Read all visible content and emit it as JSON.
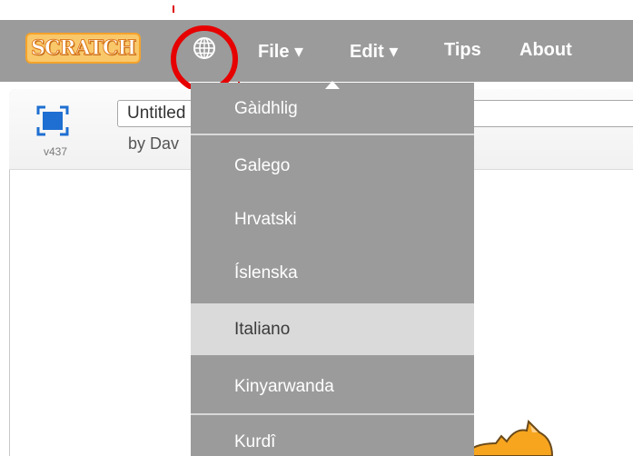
{
  "menubar": {
    "logo_text": "SCRATCH",
    "globe_icon": "globe-icon",
    "file_label": "File ▾",
    "edit_label": "Edit ▾",
    "tips_label": "Tips",
    "about_label": "About",
    "highlight_color": "#e60000",
    "bar_color": "#9b9b9b"
  },
  "project": {
    "title_value": "Untitled",
    "byline": "by Dav",
    "version": "v437",
    "fullscreen_icon": "fullscreen-icon",
    "accent_color": "#1e6fd1"
  },
  "language_menu": {
    "items": [
      {
        "label": "Gàidhlig"
      },
      {
        "label": "Galego"
      },
      {
        "label": "Hrvatski"
      },
      {
        "label": "Íslenska"
      },
      {
        "label": "Italiano",
        "selected": true
      },
      {
        "label": "Kinyarwanda"
      },
      {
        "label": "Kurdî"
      }
    ],
    "selected_color": "#dadada"
  }
}
